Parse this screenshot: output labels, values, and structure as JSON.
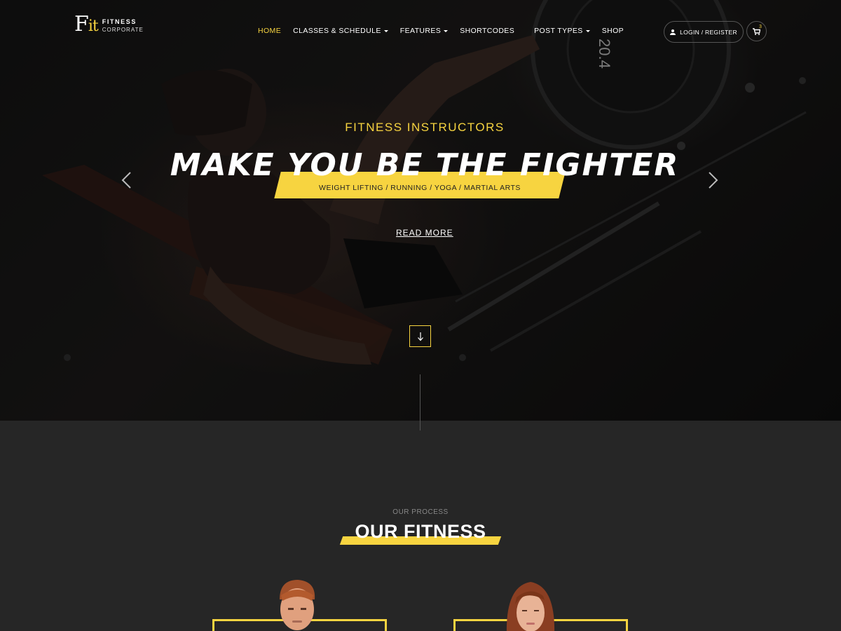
{
  "brand": {
    "mark_letter": "F",
    "mark_accent": "it",
    "name_line1": "FITNESS",
    "name_line2": "CORPORATE"
  },
  "nav": {
    "items": [
      {
        "label": "HOME",
        "active": true,
        "dropdown": false
      },
      {
        "label": "CLASSES & SCHEDULE",
        "active": false,
        "dropdown": true
      },
      {
        "label": "FEATURES",
        "active": false,
        "dropdown": true
      },
      {
        "label": "SHORTCODES",
        "active": false,
        "dropdown": false
      },
      {
        "label": "POST TYPES",
        "active": false,
        "dropdown": true
      },
      {
        "label": "SHOP",
        "active": false,
        "dropdown": false
      }
    ]
  },
  "header": {
    "login_label": "LOGIN / REGISTER",
    "cart_count": "3"
  },
  "hero": {
    "eyebrow": "FITNESS INSTRUCTORS",
    "headline": "MAKE YOU BE THE FIGHTER",
    "tags": "WEIGHT LIFTING  /  RUNNING  /  YOGA  /  MARTIAL ARTS",
    "cta": "READ MORE",
    "plate_number": "20.4"
  },
  "process": {
    "eyebrow": "OUR PROCESS",
    "title": "OUR FITNESS"
  },
  "colors": {
    "accent": "#f7d440",
    "background_dark": "#262626",
    "hero_dark": "#141414"
  },
  "icons": [
    "user-icon",
    "cart-icon",
    "chevron-left-icon",
    "chevron-right-icon",
    "arrow-down-icon"
  ]
}
